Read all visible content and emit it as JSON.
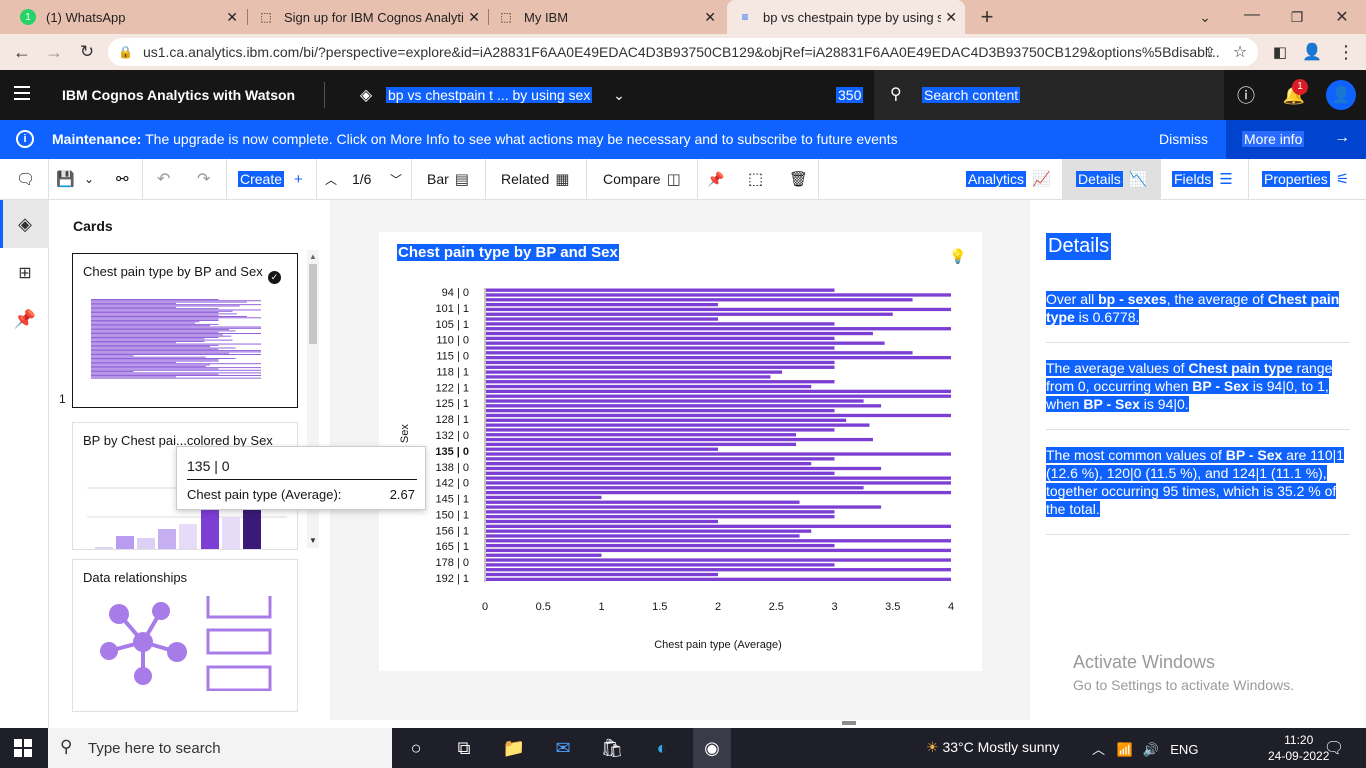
{
  "browser": {
    "tabs": [
      {
        "title": "(1) WhatsApp",
        "icon": "whatsapp-icon"
      },
      {
        "title": "Sign up for IBM Cognos Analytics",
        "icon": "ibm-icon"
      },
      {
        "title": "My IBM",
        "icon": "ibm-icon"
      },
      {
        "title": "bp vs chestpain type by using sex",
        "icon": "cognos-icon"
      }
    ],
    "url": "us1.ca.analytics.ibm.com/bi/?perspective=explore&id=iA28831F6AA0E49EDAC4D3B93750CB129&objRef=iA28831F6AA0E49EDAC4D3B93750CB129&options%5Bdisabl..."
  },
  "header": {
    "app_name": "IBM Cognos Analytics with Watson",
    "doc_title": "bp vs chestpain t ... by using sex",
    "count": "350",
    "search_placeholder": "Search content",
    "notifications": "1"
  },
  "banner": {
    "label": "Maintenance:",
    "message": " The upgrade is now complete. Click on More Info to see what actions may be necessary and to subscribe to future events",
    "dismiss": "Dismiss",
    "more_info": "More info"
  },
  "toolbar": {
    "create": "Create",
    "page": "1/6",
    "bar": "Bar",
    "related": "Related",
    "compare": "Compare",
    "analytics": "Analytics",
    "details": "Details",
    "fields": "Fields",
    "properties": "Properties"
  },
  "cards": {
    "heading": "Cards",
    "items": [
      {
        "title": "Chest pain type by BP and Sex"
      },
      {
        "title": "BP by Chest pai...colored by Sex"
      },
      {
        "title": "Data relationships"
      }
    ],
    "card_number": "1"
  },
  "tooltip": {
    "category": "135 | 0",
    "measure": "Chest pain type (Average):",
    "value": "2.67"
  },
  "chart_data": {
    "type": "bar",
    "orientation": "horizontal",
    "title": "Chest pain type by BP and Sex",
    "xlabel": "Chest pain type (Average)",
    "ylabel": "BP - Sex",
    "ylabel_visible": "- Sex",
    "xlim": [
      0,
      4
    ],
    "xticks": [
      0,
      0.5,
      1,
      1.5,
      2,
      2.5,
      3,
      3.5,
      4
    ],
    "tick_labels": [
      "94 | 0",
      "101 | 1",
      "105 | 1",
      "110 | 0",
      "115 | 0",
      "118 | 1",
      "122 | 1",
      "125 | 1",
      "128 | 1",
      "132 | 0",
      "135 | 0",
      "138 | 0",
      "142 | 0",
      "145 | 1",
      "150 | 1",
      "156 | 1",
      "165 | 1",
      "178 | 0",
      "192 | 1"
    ],
    "highlighted_label": "135 | 0",
    "values": [
      3,
      4,
      3.67,
      2,
      4,
      3.5,
      2,
      3,
      4,
      3.33,
      3,
      3.43,
      3,
      3.67,
      4,
      3,
      3,
      2.55,
      2.45,
      3,
      2.8,
      4,
      4,
      3.25,
      3.4,
      3,
      4,
      3.1,
      3.3,
      3,
      2.67,
      3.33,
      2.67,
      2,
      4,
      3,
      2.8,
      3.4,
      3,
      4,
      4,
      3.25,
      4,
      1,
      2.7,
      3.4,
      3,
      3,
      2,
      4,
      2.8,
      2.7,
      4,
      3,
      4,
      1,
      4,
      3,
      4,
      2,
      4
    ],
    "bar_color": "#7d3ed4",
    "grid": false
  },
  "details": {
    "heading": "Details",
    "insights": [
      "Over all bp - sexes, the average of Chest pain type is 0.6778.",
      "The average values of Chest pain type range from 0, occurring when BP - Sex is 94|0, to 1, when BP - Sex is 94|0.",
      "The most common values of BP - Sex are 110|1 (12.6 %), 120|0 (11.5 %), and 124|1 (11.1 %), together occurring 95 times, which is 35.2 % of the total."
    ]
  },
  "watermark": {
    "line1": "Activate Windows",
    "line2": "Go to Settings to activate Windows."
  },
  "taskbar": {
    "search_placeholder": "Type here to search",
    "weather": "33°C  Mostly sunny",
    "lang": "ENG",
    "time": "11:20",
    "date": "24-09-2022"
  }
}
